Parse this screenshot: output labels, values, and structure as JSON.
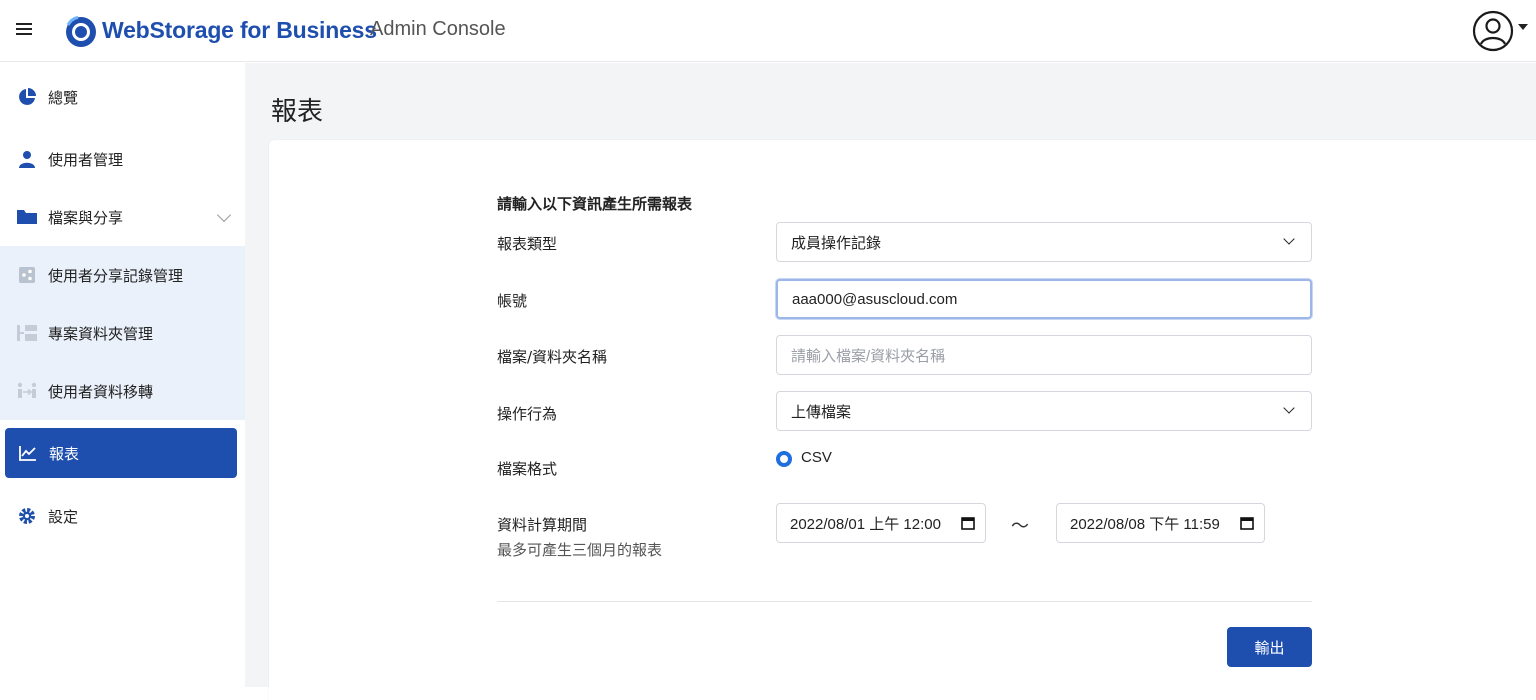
{
  "header": {
    "brand": "WebStorage for Business",
    "subtitle": "Admin Console"
  },
  "sidebar": {
    "items": [
      {
        "label": "總覽",
        "icon": "pie-chart-icon"
      },
      {
        "label": "使用者管理",
        "icon": "user-icon"
      },
      {
        "label": "檔案與分享",
        "icon": "folder-icon"
      },
      {
        "label": "使用者分享記錄管理",
        "icon": "share-icon"
      },
      {
        "label": "專案資料夾管理",
        "icon": "project-folder-icon"
      },
      {
        "label": "使用者資料移轉",
        "icon": "transfer-icon"
      },
      {
        "label": "報表",
        "icon": "line-chart-icon"
      },
      {
        "label": "設定",
        "icon": "gear-icon"
      }
    ]
  },
  "main": {
    "title": "報表",
    "form": {
      "intro": "請輸入以下資訊產生所需報表",
      "report_type_label": "報表類型",
      "report_type_value": "成員操作記錄",
      "account_label": "帳號",
      "account_value": "aaa000@asuscloud.com",
      "filename_label": "檔案/資料夾名稱",
      "filename_placeholder": "請輸入檔案/資料夾名稱",
      "action_label": "操作行為",
      "action_value": "上傳檔案",
      "format_label": "檔案格式",
      "format_value": "CSV",
      "period_label": "資料計算期間",
      "period_note": "最多可產生三個月的報表",
      "date_from": "2022/08/01 上午 12:00",
      "date_separator": "～",
      "date_to": "2022/08/08 下午 11:59",
      "export_label": "輸出"
    }
  },
  "colors": {
    "brand": "#1f4fae",
    "accent": "#1f6fe0",
    "sub_bg": "#eaf1fb"
  }
}
